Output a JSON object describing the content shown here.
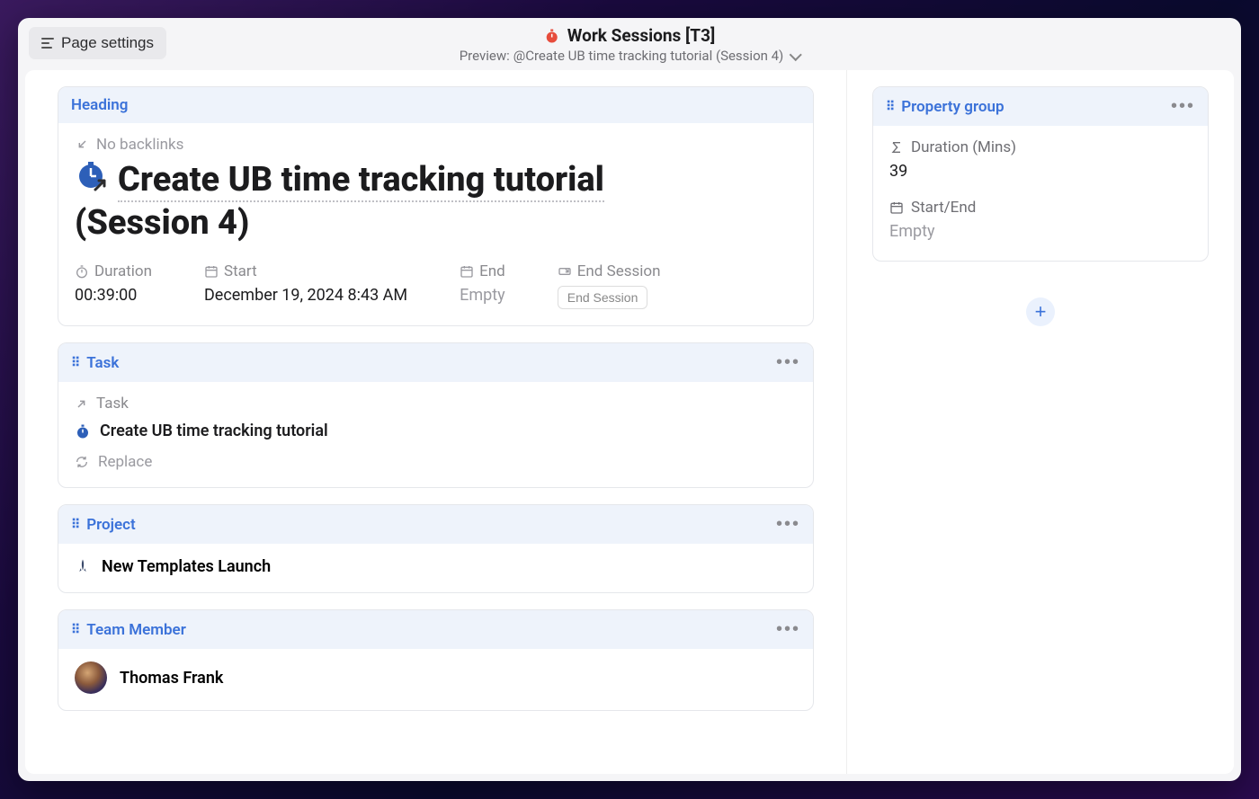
{
  "topbar": {
    "page_settings_label": "Page settings",
    "title": "Work Sessions [T3]",
    "preview_prefix": "Preview: ",
    "preview_link": "@Create UB time tracking tutorial (Session 4)"
  },
  "heading_card": {
    "header": "Heading",
    "backlinks_text": "No backlinks",
    "title_linked": "Create UB time tracking tutorial",
    "title_suffix": "(Session 4)",
    "props": {
      "duration": {
        "label": "Duration",
        "value": "00:39:00"
      },
      "start": {
        "label": "Start",
        "value": "December 19, 2024 8:43 AM"
      },
      "end": {
        "label": "End",
        "value": "Empty"
      },
      "end_session": {
        "label": "End Session",
        "button": "End Session"
      }
    }
  },
  "task_card": {
    "header": "Task",
    "relation_label": "Task",
    "item_text": "Create UB time tracking tutorial",
    "replace_label": "Replace"
  },
  "project_card": {
    "header": "Project",
    "item_text": "New Templates Launch"
  },
  "member_card": {
    "header": "Team Member",
    "item_text": "Thomas Frank"
  },
  "side_group": {
    "header": "Property group",
    "duration_mins": {
      "label": "Duration (Mins)",
      "value": "39"
    },
    "start_end": {
      "label": "Start/End",
      "value": "Empty"
    }
  }
}
